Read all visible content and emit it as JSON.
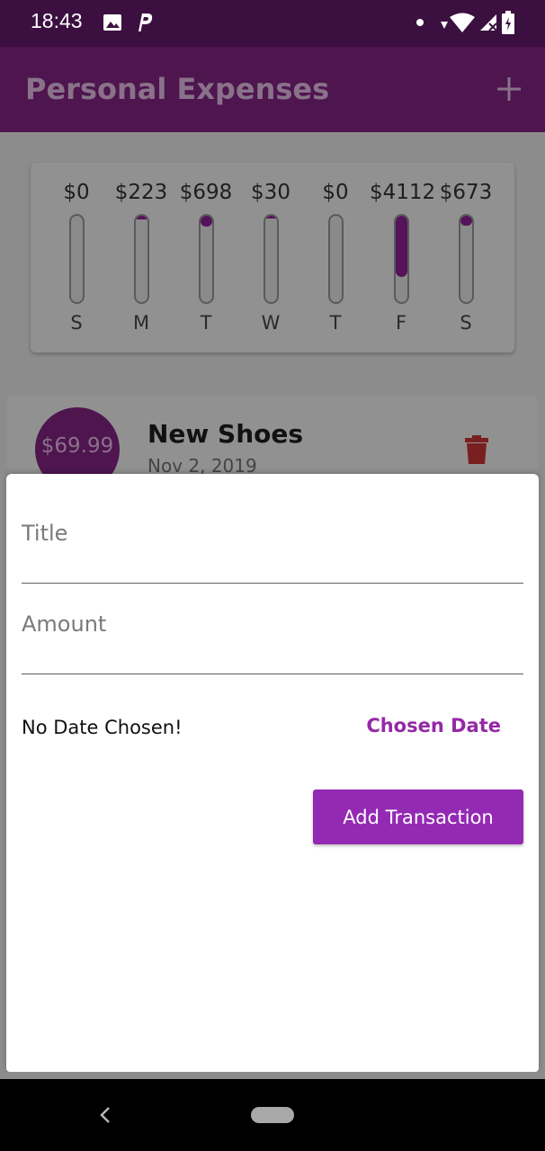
{
  "status_bar": {
    "time": "18:43",
    "icons": [
      "image-icon",
      "p-icon",
      "dot-icon",
      "wifi-icon",
      "signal-icon",
      "battery-icon"
    ]
  },
  "app_bar": {
    "title": "Personal Expenses",
    "add_icon": "plus-icon"
  },
  "chart": {
    "bars": [
      {
        "day": "S",
        "amount": "$0",
        "fraction": 0.0
      },
      {
        "day": "M",
        "amount": "$223",
        "fraction": 0.04
      },
      {
        "day": "T",
        "amount": "$698",
        "fraction": 0.12
      },
      {
        "day": "W",
        "amount": "$30",
        "fraction": 0.01
      },
      {
        "day": "T",
        "amount": "$0",
        "fraction": 0.0
      },
      {
        "day": "F",
        "amount": "$4112",
        "fraction": 0.71
      },
      {
        "day": "S",
        "amount": "$673",
        "fraction": 0.11
      }
    ]
  },
  "transaction": {
    "amount": "$69.99",
    "title": "New Shoes",
    "date": "Nov 2, 2019",
    "delete_icon": "trash-icon"
  },
  "sheet": {
    "title_placeholder": "Title",
    "amount_placeholder": "Amount",
    "no_date_text": "No Date Chosen!",
    "chosen_date_label": "Chosen Date",
    "add_button_label": "Add Transaction"
  },
  "colors": {
    "primary": "#9429b4",
    "primary_dark": "#3b1040",
    "danger": "#b71c1c"
  }
}
